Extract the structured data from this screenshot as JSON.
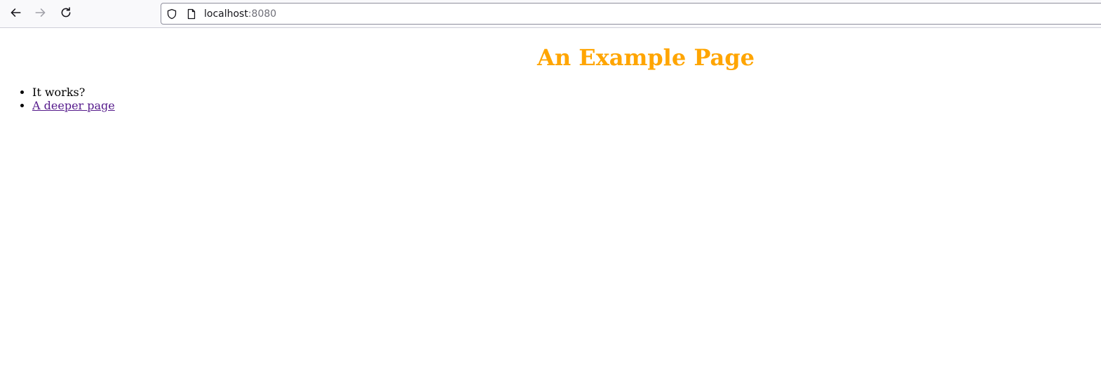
{
  "browser": {
    "url": {
      "host": "localhost",
      "port": ":8080"
    },
    "icons": {
      "back": "arrow-left-icon",
      "forward": "arrow-right-icon",
      "reload": "reload-icon",
      "shield": "shield-icon",
      "page": "page-icon"
    }
  },
  "page": {
    "title": "An Example Page",
    "title_color": "#ffa500",
    "items": [
      {
        "text": "It works?"
      },
      {
        "text": "A deeper page",
        "link_color": "#551a8b"
      }
    ]
  }
}
